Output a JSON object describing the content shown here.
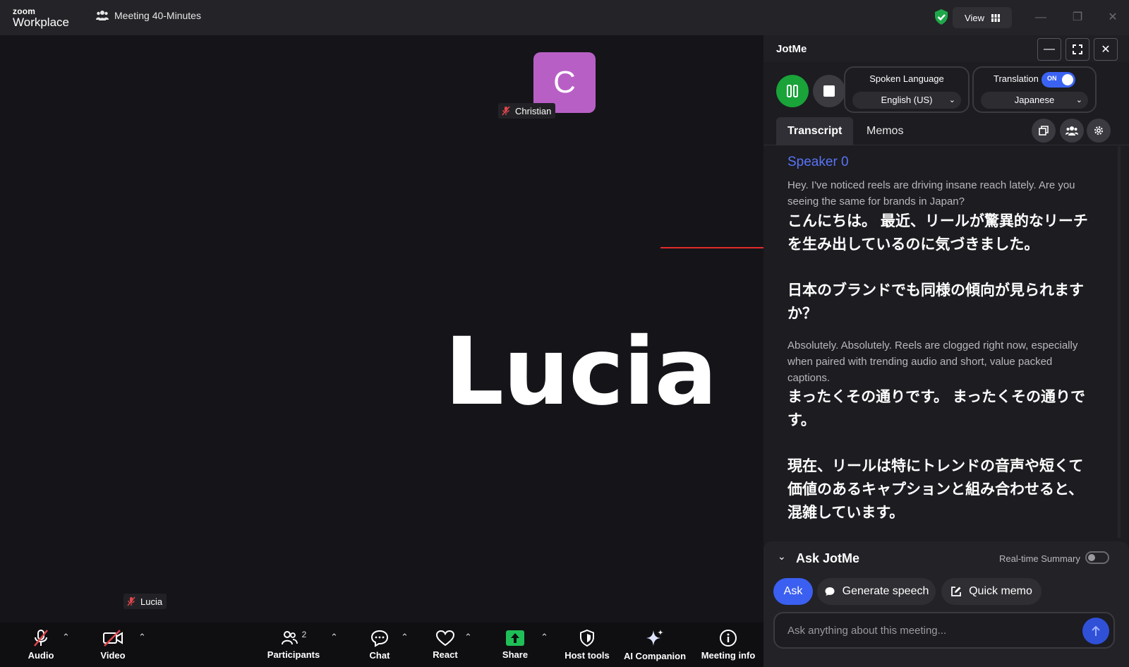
{
  "titlebar": {
    "brand_top": "zoom",
    "brand_bottom": "Workplace",
    "meeting_title": "Meeting 40-Minutes",
    "view_label": "View"
  },
  "stage": {
    "christian_initial": "C",
    "christian_name": "Christian",
    "active_speaker_name": "Lucia",
    "lucia_tag": "Lucia"
  },
  "toolbar": {
    "audio": "Audio",
    "video": "Video",
    "participants": "Participants",
    "participants_count": "2",
    "chat": "Chat",
    "react": "React",
    "share": "Share",
    "host_tools": "Host tools",
    "ai_companion": "AI Companion",
    "meeting_info": "Meeting info"
  },
  "jotme": {
    "title": "JotMe",
    "spoken_language_label": "Spoken Language",
    "spoken_language_value": "English (US)",
    "translation_label": "Translation",
    "translation_toggle": "ON",
    "translation_language": "Japanese",
    "tabs": [
      "Transcript",
      "Memos"
    ],
    "active_tab": "Transcript",
    "transcript": {
      "speaker": "Speaker 0",
      "entries": [
        {
          "en": "Hey. I've noticed reels are driving insane reach lately. Are you seeing the same for brands in Japan?",
          "jp1": "こんにちは。 最近、リールが驚異的なリーチを生み出しているのに気づきました。",
          "jp2": "日本のブランドでも同様の傾向が見られますか？"
        },
        {
          "en": "Absolutely. Absolutely. Reels are clogged right now, especially when paired with trending audio and short, value packed captions.",
          "jp1": "まったくその通りです。 まったくその通りです。",
          "jp2": "現在、リールは特にトレンドの音声や短くて価値のあるキャプションと組み合わせると、混雑しています。"
        }
      ]
    },
    "ask": {
      "title": "Ask JotMe",
      "realtime_summary_label": "Real-time Summary",
      "ask_button": "Ask",
      "generate_speech_button": "Generate speech",
      "quick_memo_button": "Quick memo",
      "input_placeholder": "Ask anything about this meeting..."
    }
  },
  "colors": {
    "accent_blue": "#3b63f3",
    "speaker_blue": "#5a74f5",
    "record_green": "#19a339",
    "avatar_purple": "#b85fc6",
    "share_green": "#1fbf57",
    "annotation_red": "#e32b2b"
  }
}
